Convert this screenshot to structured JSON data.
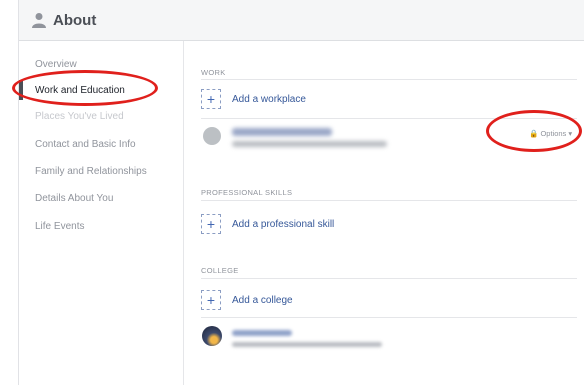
{
  "header": {
    "title": "About",
    "icon": "person-icon"
  },
  "sidebar": {
    "items": [
      {
        "label": "Overview"
      },
      {
        "label": "Work and Education"
      },
      {
        "label": "Places You've Lived"
      },
      {
        "label": "Contact and Basic Info"
      },
      {
        "label": "Family and Relationships"
      },
      {
        "label": "Details About You"
      },
      {
        "label": "Life Events"
      }
    ]
  },
  "main": {
    "work": {
      "title": "WORK",
      "add_label": "Add a workplace",
      "options_label": "Options"
    },
    "skills": {
      "title": "PROFESSIONAL SKILLS",
      "add_label": "Add a professional skill"
    },
    "college": {
      "title": "COLLEGE",
      "add_label": "Add a college"
    }
  },
  "colors": {
    "highlight_ring": "#e0201c",
    "link": "#365899"
  }
}
